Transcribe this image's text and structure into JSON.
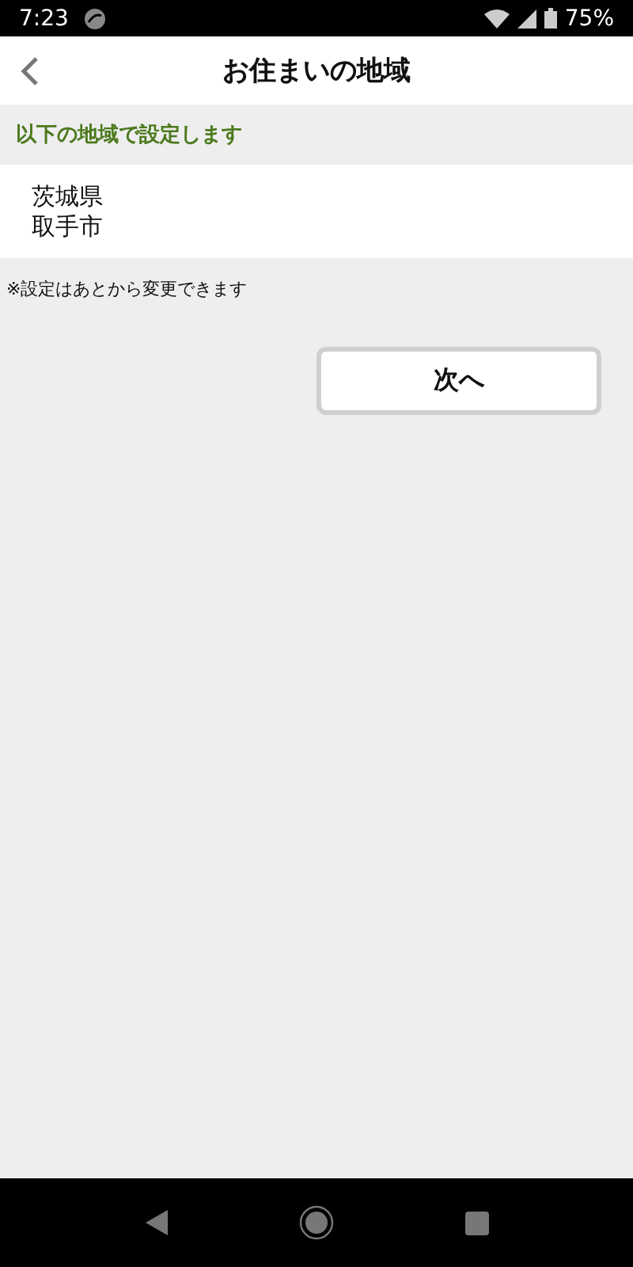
{
  "status_bar": {
    "time": "7:23",
    "battery": "75%"
  },
  "header": {
    "title": "お住まいの地域"
  },
  "section": {
    "label": "以下の地域で設定します"
  },
  "region": {
    "lines": [
      "茨城県",
      "取手市"
    ]
  },
  "note": "※設定はあとから変更できます",
  "next_button": {
    "label": "次へ"
  }
}
